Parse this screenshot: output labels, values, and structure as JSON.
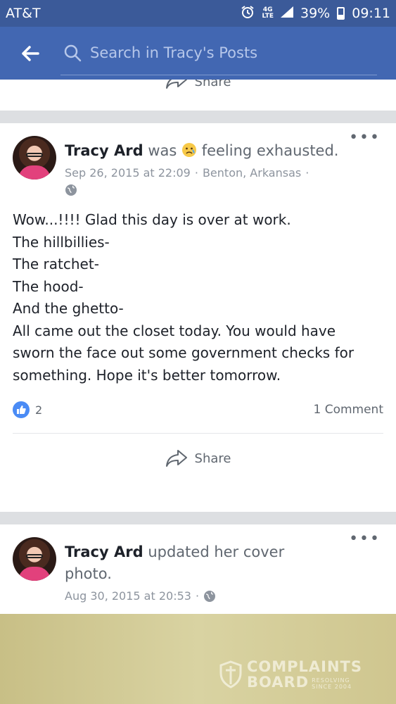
{
  "status_bar": {
    "carrier": "AT&T",
    "network": "4G LTE",
    "battery": "39%",
    "battery_level": 0.39,
    "time": "09:11"
  },
  "search": {
    "placeholder": "Search in Tracy's Posts"
  },
  "previous_post": {
    "share_label": "Share"
  },
  "posts": [
    {
      "author": "Tracy Ard",
      "action_prefix": "was",
      "feeling_emoji": "disappointed-relieved-face",
      "action_text": "feeling exhausted.",
      "timestamp": "Sep 26, 2015 at 22:09",
      "location": "Benton, Arkansas",
      "privacy_icon": "globe-icon",
      "body_lines": [
        "Wow...!!!! Glad this day is over at work.",
        "The hillbillies-",
        "The ratchet-",
        "The hood-",
        "And the ghetto-",
        "All came out the closet today. You would have",
        "sworn the face out some government checks for",
        "something. Hope it's better tomorrow."
      ],
      "likes": "2",
      "comments": "1 Comment",
      "share_label": "Share"
    },
    {
      "author": "Tracy Ard",
      "action_text": "updated her cover photo.",
      "timestamp": "Aug 30, 2015 at 20:53",
      "privacy_icon": "globe-icon"
    }
  ],
  "watermark": {
    "line1": "COMPLAINTS",
    "line2": "BOARD",
    "tag1": "RESOLVING",
    "tag2": "SINCE 2004"
  },
  "colors": {
    "status_bar": "#3b5a99",
    "header": "#4267b2",
    "like_blue": "#4a8bf5"
  }
}
